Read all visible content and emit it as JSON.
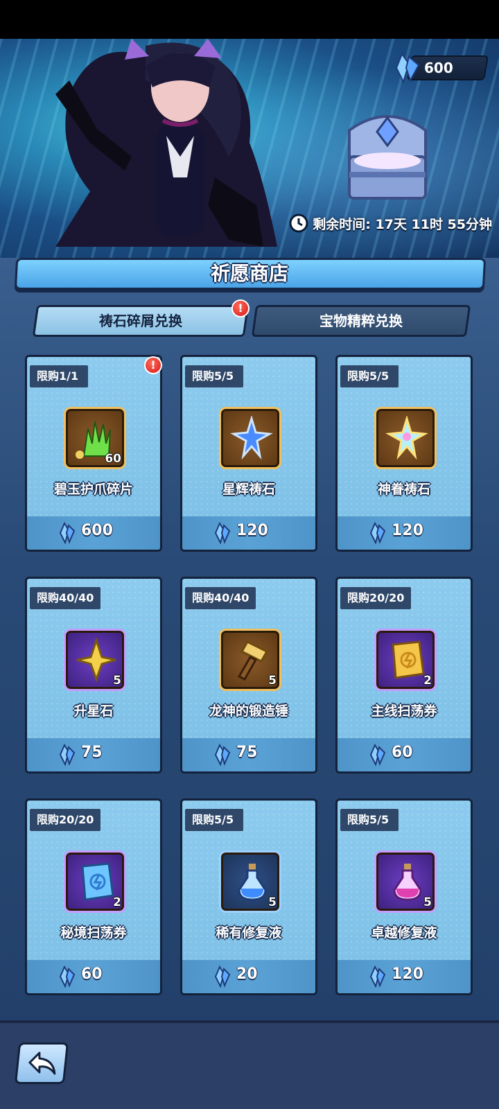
{
  "header": {
    "currency_value": "600",
    "timer_text": "剩余时间: 17天 11时 55分钟"
  },
  "shop": {
    "title": "祈愿商店",
    "tabs": [
      {
        "label": "祷石碎屑兑换",
        "selected": true,
        "alert": "!"
      },
      {
        "label": "宝物精粹兑换",
        "selected": false
      }
    ]
  },
  "items": [
    {
      "limit": "限购1/1",
      "name": "碧玉护爪碎片",
      "qty": "60",
      "price": "600",
      "icon": "jade-claw-shard-icon",
      "alert": "!"
    },
    {
      "limit": "限购5/5",
      "name": "星辉祷石",
      "qty": "",
      "price": "120",
      "icon": "starlight-prayer-stone-icon"
    },
    {
      "limit": "限购5/5",
      "name": "神眷祷石",
      "qty": "",
      "price": "120",
      "icon": "divine-prayer-stone-icon"
    },
    {
      "limit": "限购40/40",
      "name": "升星石",
      "qty": "5",
      "price": "75",
      "icon": "star-up-stone-icon"
    },
    {
      "limit": "限购40/40",
      "name": "龙神的锻造锤",
      "qty": "5",
      "price": "75",
      "icon": "forge-hammer-icon"
    },
    {
      "limit": "限购20/20",
      "name": "主线扫荡券",
      "qty": "2",
      "price": "60",
      "icon": "main-sweep-ticket-icon"
    },
    {
      "limit": "限购20/20",
      "name": "秘境扫荡券",
      "qty": "2",
      "price": "60",
      "icon": "secret-sweep-ticket-icon"
    },
    {
      "limit": "限购5/5",
      "name": "稀有修复液",
      "qty": "5",
      "price": "20",
      "icon": "rare-repair-potion-icon"
    },
    {
      "limit": "限购5/5",
      "name": "卓越修复液",
      "qty": "5",
      "price": "120",
      "icon": "excellent-repair-potion-icon"
    }
  ],
  "colors": {
    "card_bg": "#8ccbee",
    "price_bar": "#5aa2d6",
    "alert": "#d31a1a"
  }
}
